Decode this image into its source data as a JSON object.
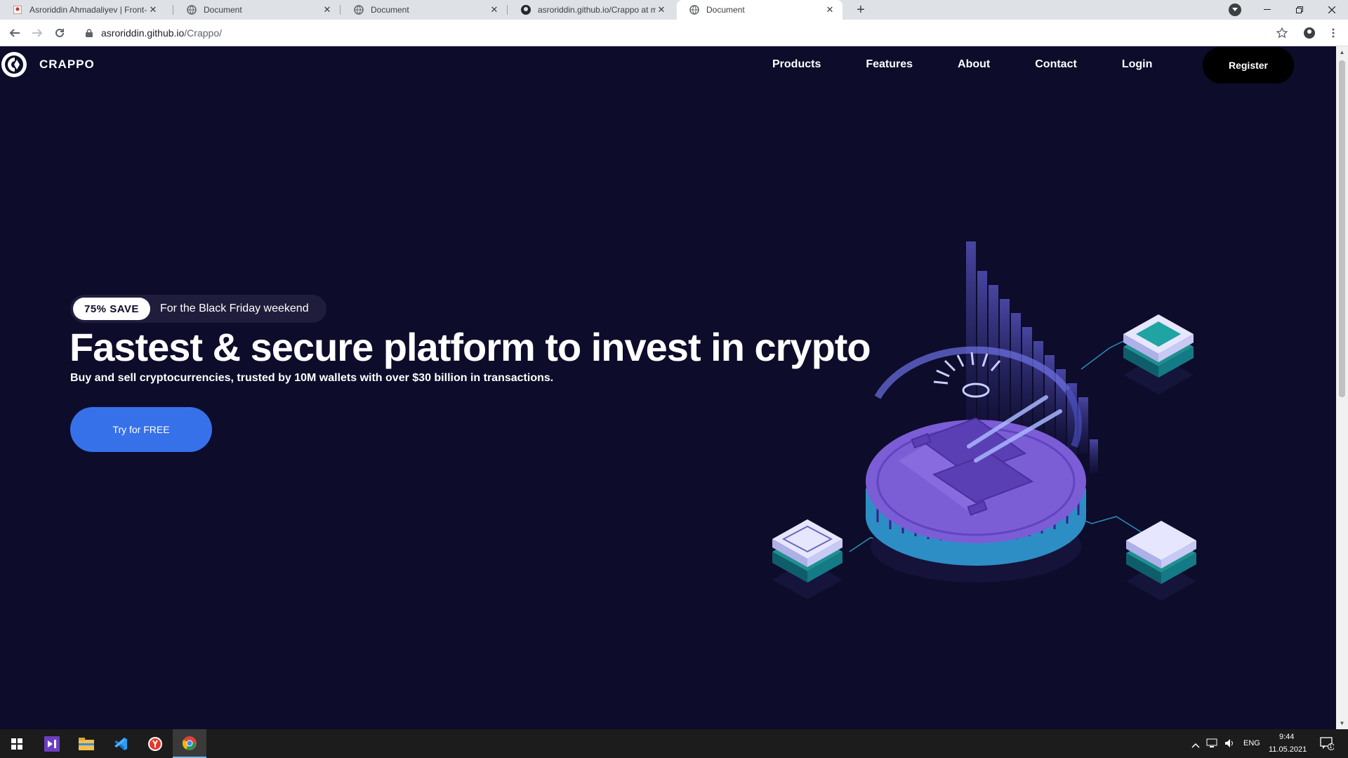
{
  "browser": {
    "tabs": [
      {
        "title": "Asroriddin Ahmadaliyev | Front-E",
        "icon": "profile-favicon"
      },
      {
        "title": "Document",
        "icon": "globe-icon"
      },
      {
        "title": "Document",
        "icon": "globe-icon"
      },
      {
        "title": "asroriddin.github.io/Crappo at m",
        "icon": "github-icon"
      },
      {
        "title": "Document",
        "icon": "globe-icon",
        "active": true
      }
    ],
    "url_host": "asroriddin.github.io",
    "url_path": "/Crappo/"
  },
  "site": {
    "logo_text": "CRAPPO",
    "nav": [
      "Products",
      "Features",
      "About",
      "Contact",
      "Login"
    ],
    "register_label": "Register",
    "promo_badge": "75% SAVE",
    "promo_text": "For the Black Friday weekend",
    "hero_title": "Fastest & secure platform to invest in crypto",
    "hero_subtitle": "Buy and sell cryptocurrencies, trusted by 10M wallets with over $30 billion in transactions.",
    "cta_label": "Try for FREE",
    "colors": {
      "background": "#0d0c2a",
      "cta": "#3671e9",
      "coin": "#7b5dd6"
    }
  },
  "taskbar": {
    "apps": [
      "windows-start-icon",
      "visual-studio-icon",
      "file-explorer-icon",
      "vscode-icon",
      "yandex-browser-icon",
      "chrome-icon"
    ],
    "lang": "ENG",
    "time": "9:44",
    "date": "11.05.2021",
    "notifications": "1"
  }
}
